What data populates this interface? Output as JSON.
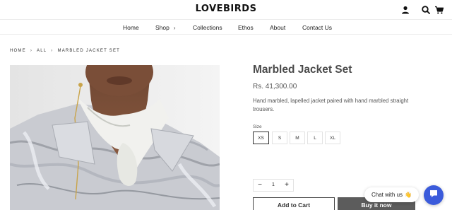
{
  "header": {
    "logo": "LOVEBIRDS",
    "icons": [
      "user-icon",
      "search-icon",
      "cart-icon"
    ]
  },
  "nav": {
    "items": [
      {
        "label": "Home"
      },
      {
        "label": "Shop",
        "has_dropdown": true
      },
      {
        "label": "Collections"
      },
      {
        "label": "Ethos"
      },
      {
        "label": "About"
      },
      {
        "label": "Contact Us"
      }
    ]
  },
  "breadcrumb": [
    "HOME",
    "ALL",
    "MARBLED JACKET SET"
  ],
  "product": {
    "title": "Marbled Jacket Set",
    "price": "Rs. 41,300.00",
    "description": "Hand marbled, lapelled jacket paired with hand marbled straight trousers.",
    "size_label": "Size",
    "sizes": [
      "XS",
      "S",
      "M",
      "L",
      "XL"
    ],
    "selected_size": "XS",
    "quantity": {
      "minus": "−",
      "value": "1",
      "plus": "+"
    },
    "add_to_cart": "Add to Cart",
    "buy_now": "Buy it now"
  },
  "chat": {
    "label": "Chat with us",
    "emoji": "👋",
    "launcher_color": "#3b5bdb"
  },
  "colors": {
    "buy_now_bg": "#5c5c5c",
    "title_text": "#4a4a4a"
  }
}
